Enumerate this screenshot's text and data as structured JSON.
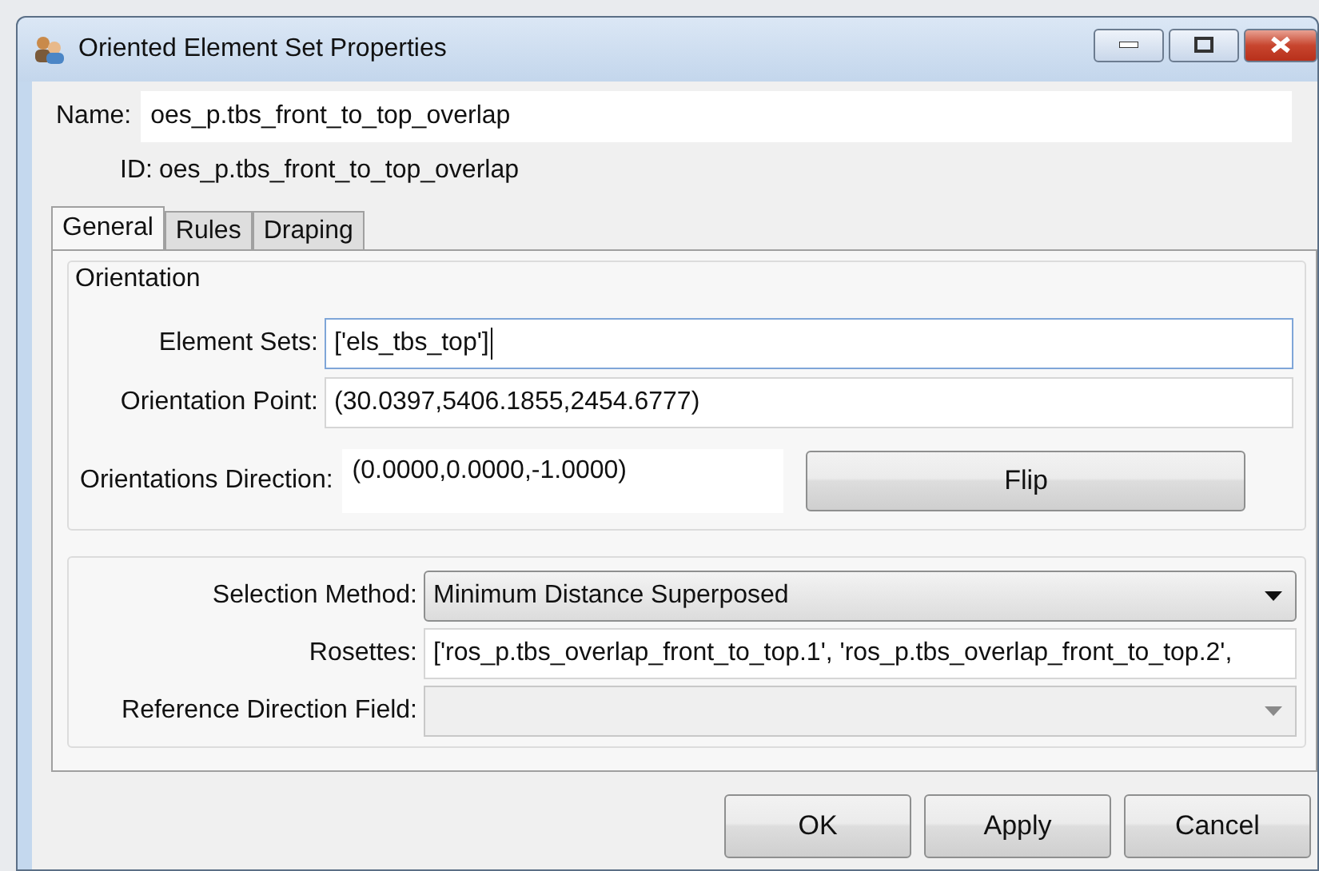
{
  "window": {
    "title": "Oriented Element Set Properties"
  },
  "name": {
    "label": "Name:",
    "value": "oes_p.tbs_front_to_top_overlap"
  },
  "id": {
    "label": "ID:",
    "value": "oes_p.tbs_front_to_top_overlap"
  },
  "tabs": [
    {
      "label": "General",
      "selected": true
    },
    {
      "label": "Rules",
      "selected": false
    },
    {
      "label": "Draping",
      "selected": false
    }
  ],
  "orientation": {
    "title": "Orientation",
    "fields": [
      {
        "label": "Element Sets:",
        "value": "['els_tbs_top']",
        "focused": true
      },
      {
        "label": "Orientation Point:",
        "value": "(30.0397,5406.1855,2454.6777)",
        "focused": false
      }
    ],
    "direction": {
      "label": "Orientations Direction:",
      "value": "(0.0000,0.0000,-1.0000)"
    },
    "flip_button": "Flip"
  },
  "selection": [
    {
      "kind": "dropdown",
      "label": "Selection Method:",
      "value": "Minimum Distance Superposed"
    },
    {
      "kind": "text",
      "label": "Rosettes:",
      "value": "['ros_p.tbs_overlap_front_to_top.1', 'ros_p.tbs_overlap_front_to_top.2',"
    },
    {
      "kind": "combo",
      "label": "Reference Direction Field:"
    }
  ],
  "buttons": [
    "OK",
    "Apply",
    "Cancel"
  ]
}
